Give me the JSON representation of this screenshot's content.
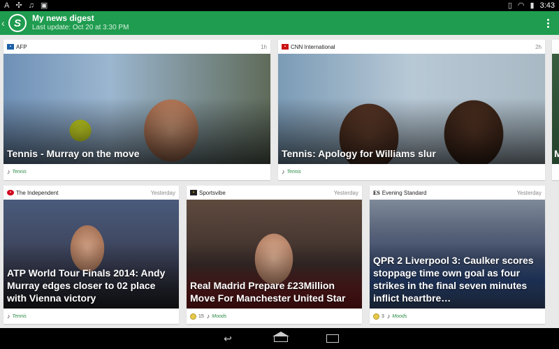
{
  "statusbar": {
    "left_icons": [
      "A",
      "✣",
      "♫",
      "▣"
    ],
    "time": "3:43"
  },
  "header": {
    "title": "My news digest",
    "subtitle": "Last update: Oct 20 at 3:30 PM",
    "logo_letter": "S",
    "accent_color": "#1f9c4f"
  },
  "cards": [
    {
      "source": "AFP",
      "time": "1h",
      "headline": "Tennis - Murray on the move",
      "tag": "Tennis"
    },
    {
      "source": "CNN International",
      "time": "2h",
      "headline": "Tennis: Apology for Williams slur",
      "tag": "Tennis"
    },
    {
      "source": "The Independent",
      "time": "Yesterday",
      "headline": "ATP World Tour Finals 2014: Andy Murray edges closer to 02 place with Vienna victory",
      "tag": "Tennis"
    },
    {
      "source": "Sportsvibe",
      "time": "Yesterday",
      "headline": "Real Madrid Prepare £23Million Move For Manchester United Star",
      "mood_count": "15",
      "tag": "Moods"
    },
    {
      "source": "Evening Standard",
      "time": "Yesterday",
      "headline": "QPR 2 Liverpool 3: Caulker scores stoppage time own goal as four strikes in the final seven minutes inflict heartbre…",
      "mood_count": "3",
      "tag": "Moods"
    }
  ],
  "peek": {
    "headline_fragment": "M"
  }
}
